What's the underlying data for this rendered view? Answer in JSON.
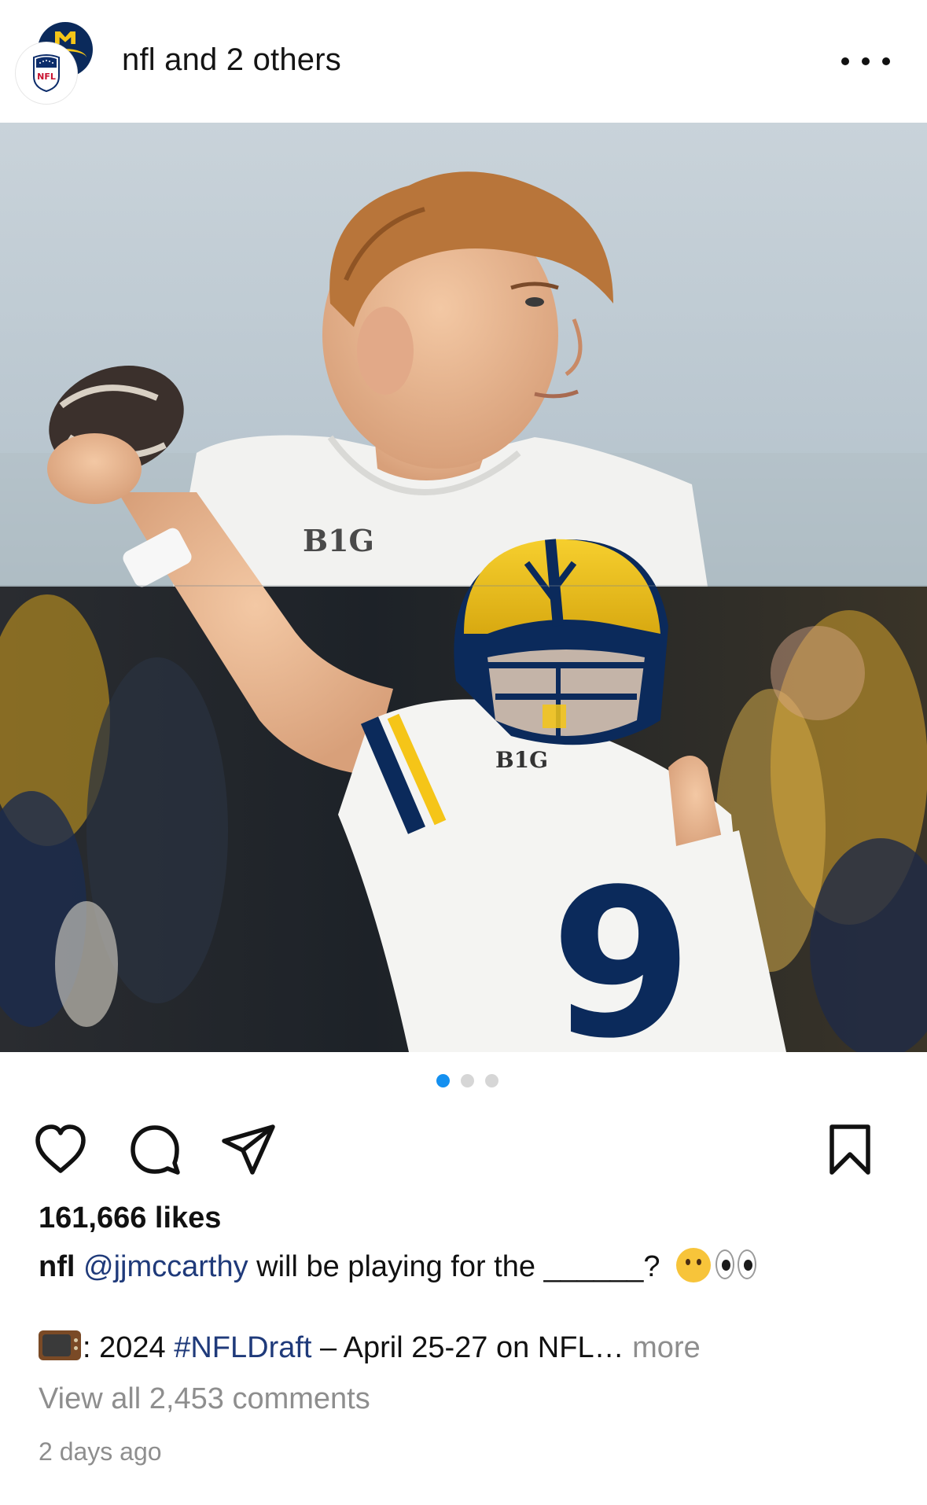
{
  "header": {
    "title": "nfl and 2 others",
    "more_icon": "more-horizontal-icon",
    "avatars": [
      "michigan-avatar",
      "nfl-avatar"
    ]
  },
  "post": {
    "image_description_icon": "post-photo",
    "carousel": {
      "count": 3,
      "active_index": 0
    }
  },
  "actions": {
    "icons": [
      "heart-icon",
      "comment-icon",
      "share-icon",
      "bookmark-icon"
    ]
  },
  "engagement": {
    "likes": "161,666 likes"
  },
  "caption": {
    "username": "nfl",
    "mention": "@jjmccarthy",
    "text": " will be playing for the ______? ",
    "line2_prefix": ": 2024 ",
    "hashtag": "#NFLDraft",
    "line2_suffix": " – April 25-27 on NFL…",
    "more": " more"
  },
  "comments": {
    "view_all": "View all 2,453 comments"
  },
  "timestamp": "2 days ago",
  "colors": {
    "link": "#1f3a7a",
    "muted": "#8e8e8e",
    "dot_active": "#1490f0",
    "dot_inactive": "#d6d6d6",
    "michigan_blue": "#0b2a5b",
    "michigan_maize": "#f5c518"
  }
}
